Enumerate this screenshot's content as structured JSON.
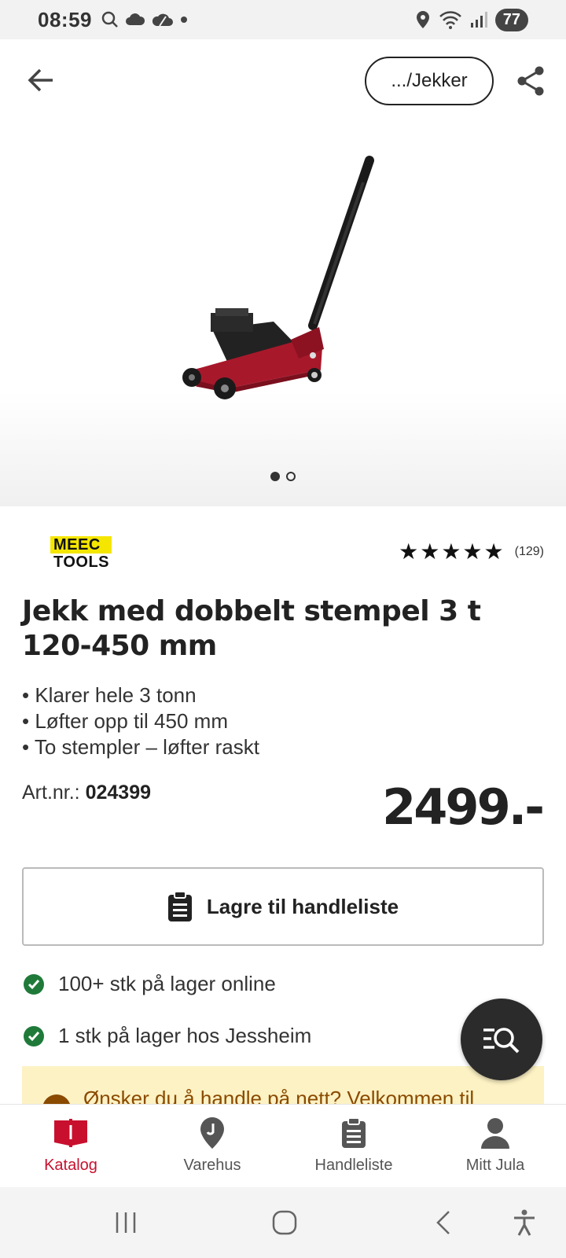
{
  "status_bar": {
    "time": "08:59",
    "battery": "77"
  },
  "header": {
    "breadcrumb": ".../Jekker"
  },
  "carousel": {
    "count": 2,
    "active_index": 0
  },
  "brand": {
    "line1": "MEEC",
    "line2": "TOOLS"
  },
  "rating": {
    "stars": 5,
    "count": "(129)"
  },
  "product": {
    "title": "Jekk med dobbelt stempel 3 t 120-450 mm",
    "bullets": [
      "• Klarer hele 3 tonn",
      "• Løfter opp til 450 mm",
      "• To stempler – løfter raskt"
    ],
    "artnr_label": "Art.nr.:",
    "artnr_value": "024399",
    "price": "2499.-"
  },
  "actions": {
    "save_label": "Lagre til handleliste"
  },
  "stock": [
    {
      "text": "100+ stk på lager online"
    },
    {
      "text": "1 stk på lager hos Jessheim"
    }
  ],
  "banner": {
    "text": "Ønsker du å handle på nett? Velkommen til"
  },
  "bottom_nav": [
    {
      "label": "Katalog",
      "icon": "catalog-book-icon",
      "active": true
    },
    {
      "label": "Varehus",
      "icon": "location-pin-icon",
      "active": false
    },
    {
      "label": "Handleliste",
      "icon": "clipboard-icon",
      "active": false
    },
    {
      "label": "Mitt Jula",
      "icon": "person-icon",
      "active": false
    }
  ],
  "colors": {
    "accent": "#c8102e",
    "stock_green": "#1f7a3a",
    "banner_bg": "#fdf2c4",
    "fab": "#2b2b2b"
  }
}
